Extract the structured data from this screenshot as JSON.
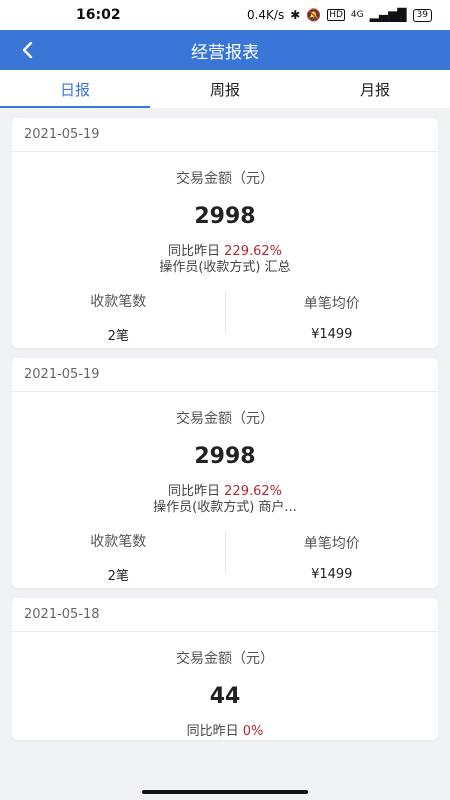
{
  "status_bar": {
    "time": "16:02",
    "network_speed": "0.4K/s",
    "hd_badge": "HD",
    "signal_label": "4G",
    "battery": "39"
  },
  "header": {
    "title": "经营报表"
  },
  "tabs": [
    {
      "label": "日报",
      "active": true
    },
    {
      "label": "周报",
      "active": false
    },
    {
      "label": "月报",
      "active": false
    }
  ],
  "reports": [
    {
      "date": "2021-05-19",
      "amount_label": "交易金额（元）",
      "amount": "2998",
      "compare_label": "同比昨日",
      "compare_value": "229.62%",
      "operator": "操作员(收款方式) 汇总",
      "count_label": "收款笔数",
      "count_value": "2笔",
      "avg_label": "单笔均价",
      "avg_value": "¥1499"
    },
    {
      "date": "2021-05-19",
      "amount_label": "交易金额（元）",
      "amount": "2998",
      "compare_label": "同比昨日",
      "compare_value": "229.62%",
      "operator": "操作员(收款方式) 商户...",
      "count_label": "收款笔数",
      "count_value": "2笔",
      "avg_label": "单笔均价",
      "avg_value": "¥1499"
    },
    {
      "date": "2021-05-18",
      "amount_label": "交易金额（元）",
      "amount": "44",
      "compare_label": "同比昨日",
      "compare_value": "0%"
    }
  ],
  "colors": {
    "primary": "#3a76d8",
    "up": "#b3292e",
    "background": "#f1f2f5"
  }
}
